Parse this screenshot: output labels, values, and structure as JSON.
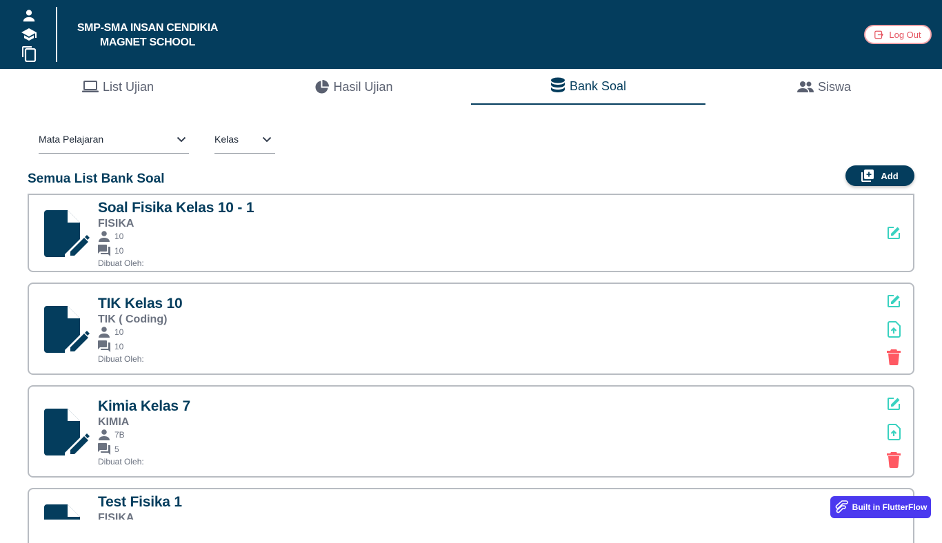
{
  "header": {
    "school_line1": "SMP-SMA INSAN CENDIKIA",
    "school_line2": "MAGNET SCHOOL",
    "icons": [
      "person-icon",
      "school-icon",
      "copy-icon"
    ],
    "logout_label": "Log Out"
  },
  "tabs": [
    {
      "label": "List Ujian",
      "icon": "laptop-icon",
      "active": false
    },
    {
      "label": "Hasil Ujian",
      "icon": "pie-chart-icon",
      "active": false
    },
    {
      "label": "Bank Soal",
      "icon": "database-icon",
      "active": true
    },
    {
      "label": "Siswa",
      "icon": "people-icon",
      "active": false
    }
  ],
  "filters": {
    "subject_label": "Mata Pelajaran",
    "class_label": "Kelas"
  },
  "section": {
    "title": "Semua List Bank Soal",
    "add_label": "Add"
  },
  "cards": [
    {
      "title": "Soal  Fisika Kelas 10 - 1",
      "subject": "FISIKA",
      "class": "10",
      "questions": "10",
      "creator": "Dibuat Oleh:"
    },
    {
      "title": "TIK Kelas 10",
      "subject": "TIK ( Coding)",
      "class": "10",
      "questions": "10",
      "creator": "Dibuat Oleh:"
    },
    {
      "title": "Kimia Kelas 7",
      "subject": "KIMIA",
      "class": "7B",
      "questions": "5",
      "creator": "Dibuat Oleh:"
    },
    {
      "title": "Test Fisika 1",
      "subject": "FISIKA",
      "class": "",
      "questions": "",
      "creator": ""
    }
  ],
  "colors": {
    "primary": "#043d5d",
    "teal": "#39d2c0",
    "danger": "#ff5963",
    "flutterflow": "#4b39ef"
  },
  "badge": {
    "label": "Built in FlutterFlow"
  }
}
